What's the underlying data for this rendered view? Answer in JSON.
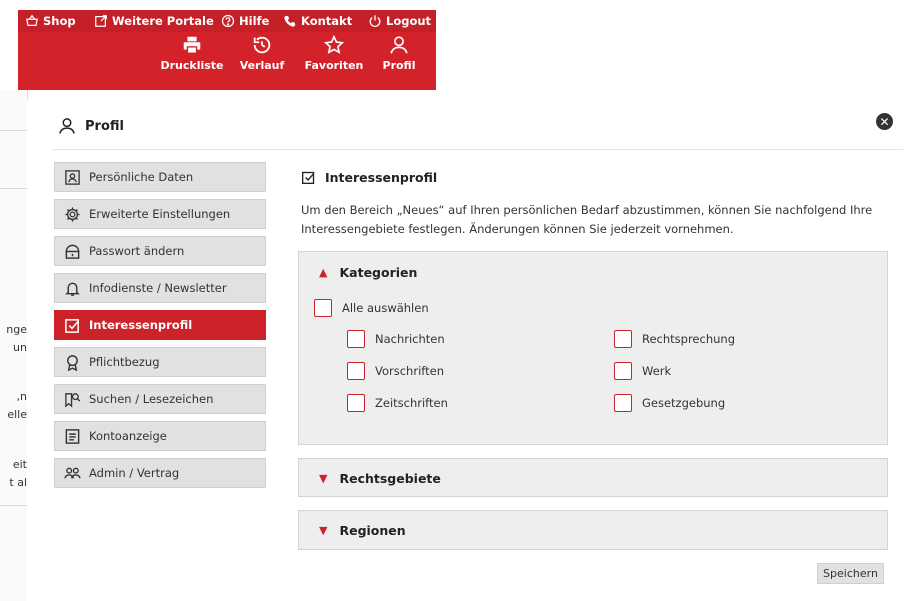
{
  "topnav": {
    "links": [
      {
        "label": "Shop",
        "icon": "basket-icon"
      },
      {
        "label": "Weitere Portale",
        "icon": "external-link-icon"
      },
      {
        "label": "Hilfe",
        "icon": "help-icon"
      },
      {
        "label": "Kontakt",
        "icon": "phone-icon"
      },
      {
        "label": "Logout",
        "icon": "power-icon"
      }
    ],
    "icons": [
      {
        "label": "Druckliste",
        "icon": "printer-icon"
      },
      {
        "label": "Verlauf",
        "icon": "history-icon"
      },
      {
        "label": "Favoriten",
        "icon": "star-icon"
      },
      {
        "label": "Profil",
        "icon": "user-icon"
      }
    ]
  },
  "background": {
    "fragments": [
      "nge",
      "un",
      "n,",
      "elle",
      "eit",
      "t al"
    ]
  },
  "modal": {
    "title": "Profil",
    "close": "✕"
  },
  "sidebar": {
    "items": [
      {
        "label": "Persönliche Daten",
        "icon": "id-card-icon"
      },
      {
        "label": "Erweiterte Einstellungen",
        "icon": "gear-icon"
      },
      {
        "label": "Passwort ändern",
        "icon": "lock-icon"
      },
      {
        "label": "Infodienste / Newsletter",
        "icon": "bell-icon"
      },
      {
        "label": "Interessenprofil",
        "icon": "checkbox-icon",
        "active": true
      },
      {
        "label": "Pflichtbezug",
        "icon": "award-icon"
      },
      {
        "label": "Suchen / Lesezeichen",
        "icon": "search-bookmark-icon"
      },
      {
        "label": "Kontoanzeige",
        "icon": "document-icon"
      },
      {
        "label": "Admin / Vertrag",
        "icon": "users-icon"
      }
    ]
  },
  "main": {
    "title": "Interessenprofil",
    "description": "Um den Bereich „Neues“ auf Ihren persönlichen Bedarf abzustimmen, können Sie nachfolgend Ihre Interessengebiete festlegen. Änderungen können Sie jederzeit vornehmen.",
    "kategorien": {
      "title": "Kategorien",
      "select_all": "Alle auswählen",
      "options": [
        "Nachrichten",
        "Rechtsprechung",
        "Vorschriften",
        "Werk",
        "Zeitschriften",
        "Gesetzgebung"
      ]
    },
    "rechtsgebiete": {
      "title": "Rechtsgebiete"
    },
    "regionen": {
      "title": "Regionen"
    },
    "save": "Speichern"
  },
  "colors": {
    "accent": "#cc2229",
    "panel": "#eeeeee",
    "sidebar": "#e1e1e1"
  }
}
